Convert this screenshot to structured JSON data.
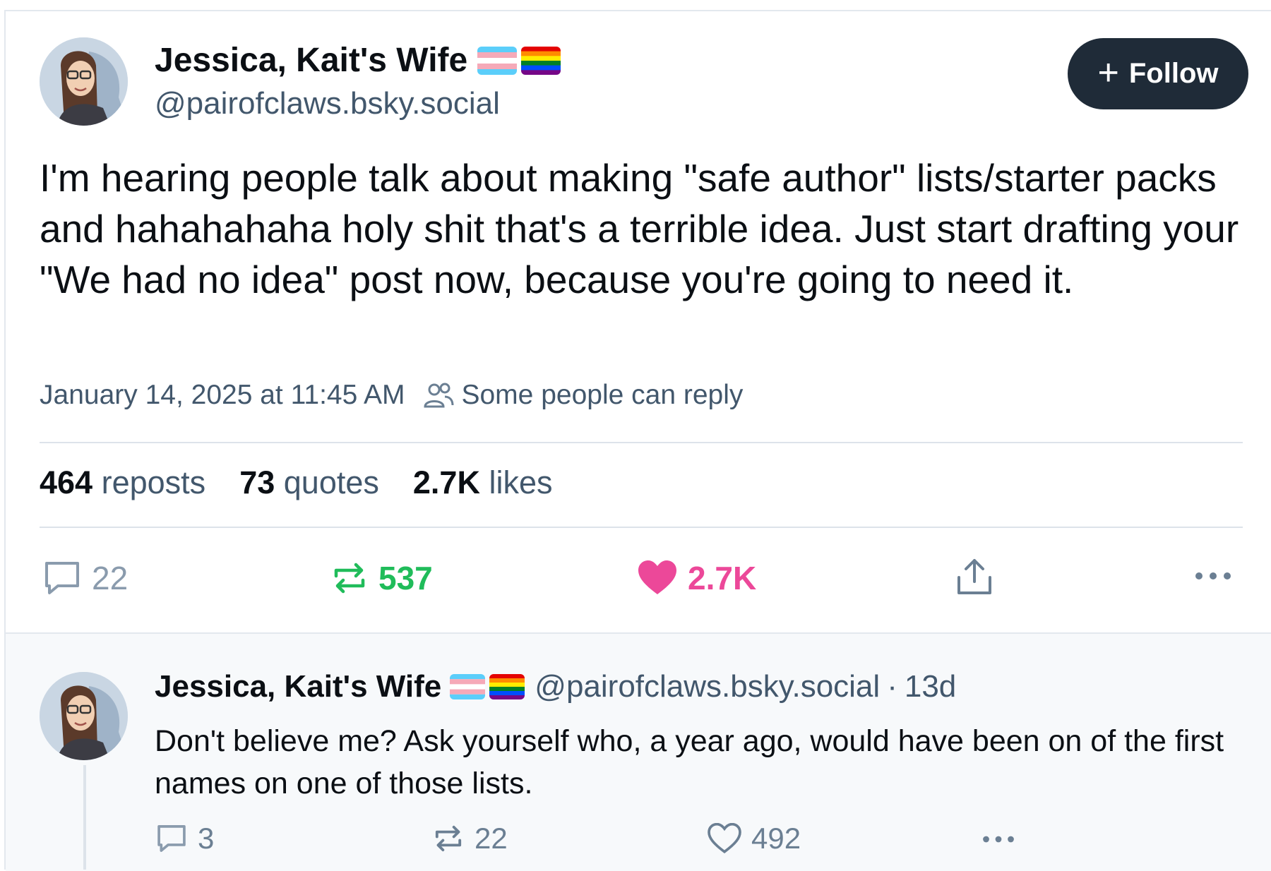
{
  "post": {
    "author_name": "Jessica, Kait's Wife",
    "author_handle": "@pairofclaws.bsky.social",
    "follow_label": "Follow",
    "text": "I'm hearing people talk about making \"safe author\" lists/starter packs and hahahahaha holy shit that's a terrible idea. Just start drafting your \"We had no idea\" post now, because you're going to need it.",
    "timestamp": "January 14, 2025 at 11:45 AM",
    "reply_setting": "Some people can reply",
    "stats": {
      "reposts_count": "464",
      "reposts_label": "reposts",
      "quotes_count": "73",
      "quotes_label": "quotes",
      "likes_count": "2.7K",
      "likes_label": "likes"
    },
    "actions": {
      "replies": "22",
      "reposts": "537",
      "likes": "2.7K"
    }
  },
  "reply": {
    "author_name": "Jessica, Kait's Wife",
    "author_handle": "@pairofclaws.bsky.social",
    "time": "13d",
    "text": "Don't believe me? Ask yourself who, a year ago, would have been on of the first names on one of those lists.",
    "actions": {
      "replies": "3",
      "reposts": "22",
      "likes": "492"
    }
  },
  "icons": {
    "flags": [
      "transgender-flag",
      "rainbow-flag"
    ],
    "people": "people-icon",
    "reply": "speech-bubble-icon",
    "repost": "repost-icon",
    "like": "heart-icon",
    "share": "share-icon",
    "more": "ellipsis-icon"
  },
  "colors": {
    "follow_bg": "#1f2b38",
    "repost_active": "#20bc5a",
    "like_active": "#ec4899",
    "muted": "#42576c"
  }
}
